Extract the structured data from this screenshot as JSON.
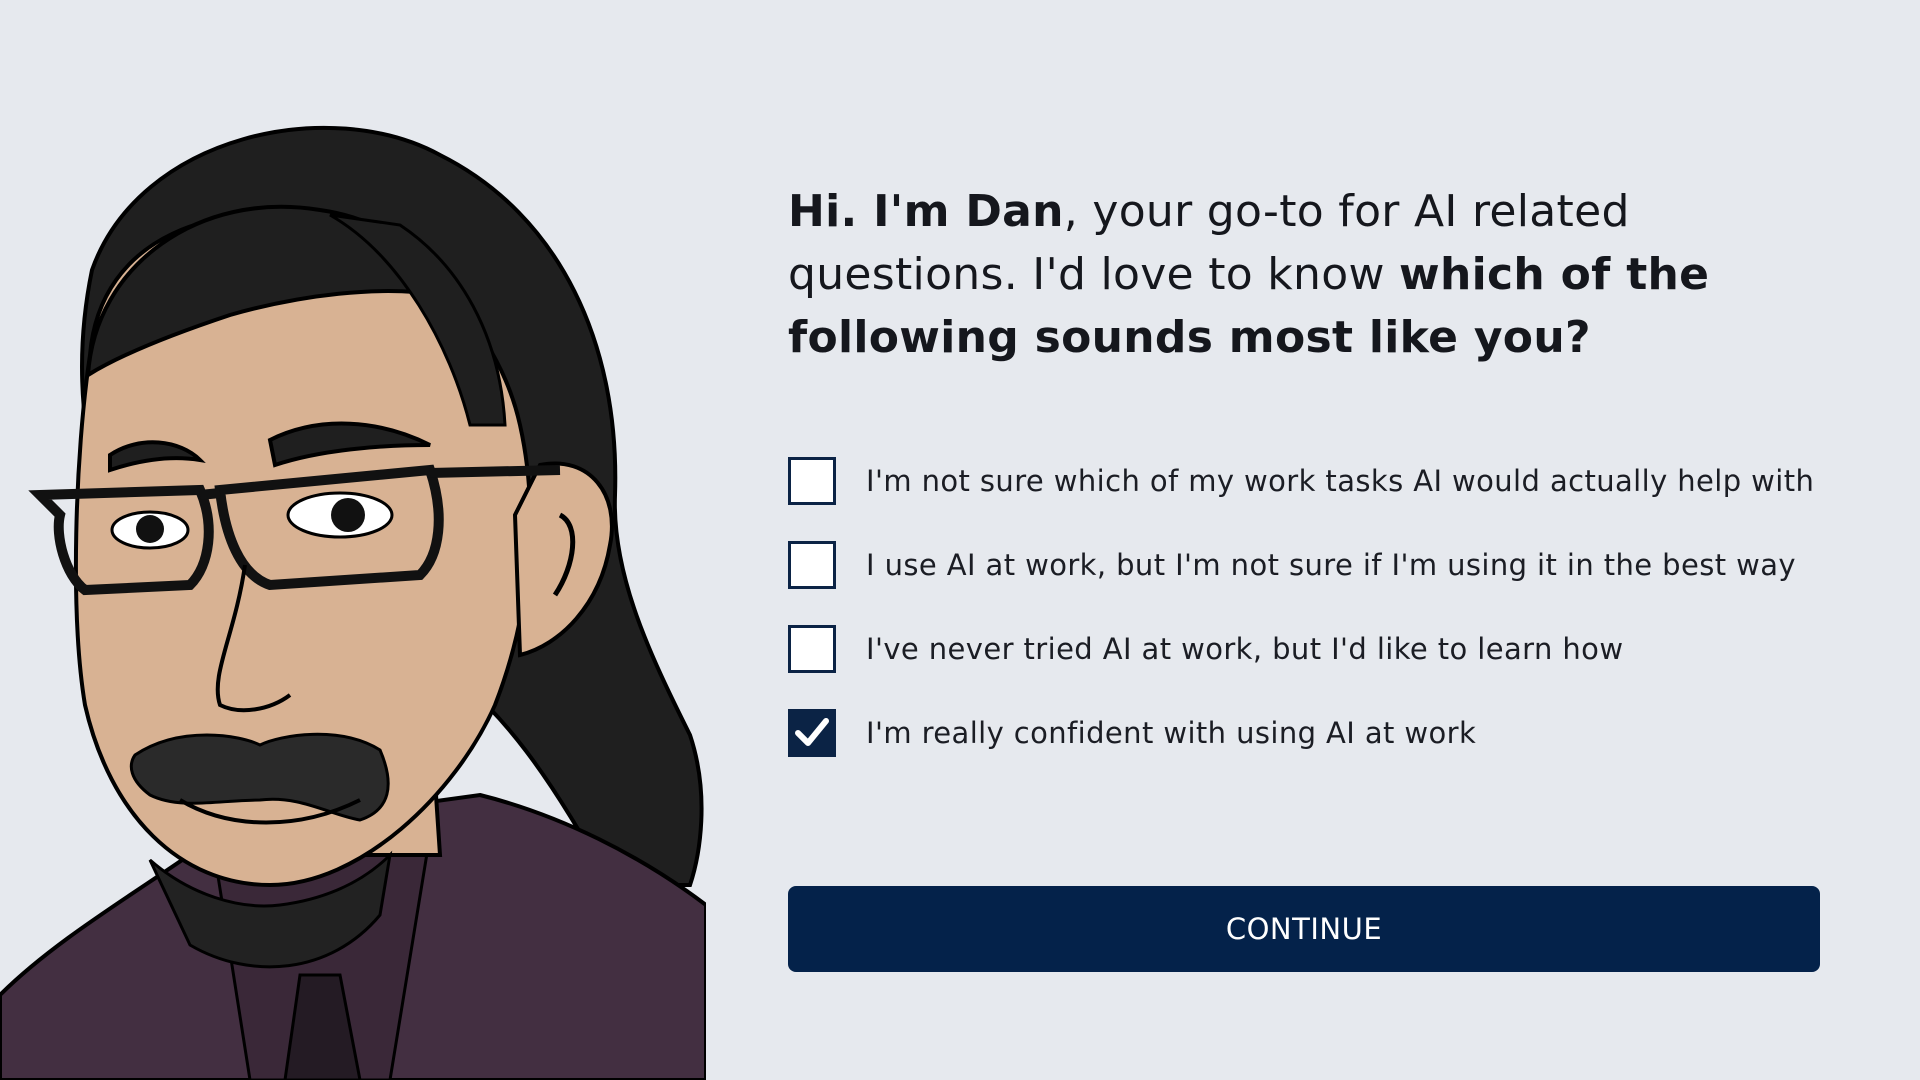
{
  "intro": {
    "greeting": "Hi. I'm Dan",
    "text1": ", your go-to for AI related questions. I'd love to know ",
    "question": "which of the following sounds most like you?"
  },
  "options": [
    {
      "label": "I'm not sure which of my work tasks AI would actually help with",
      "checked": false
    },
    {
      "label": "I use AI at work, but I'm not sure if I'm using it in the best way",
      "checked": false
    },
    {
      "label": "I've never tried AI at work, but I'd like to learn how",
      "checked": false
    },
    {
      "label": "I'm really confident with using AI at work",
      "checked": true
    }
  ],
  "continue_label": "CONTINUE",
  "colors": {
    "background": "#e6e9ee",
    "accent": "#04224a",
    "skin": "#d8b293",
    "hair": "#1f1f1f",
    "shirt": "#432f41"
  },
  "illustration": "avatar-dan"
}
